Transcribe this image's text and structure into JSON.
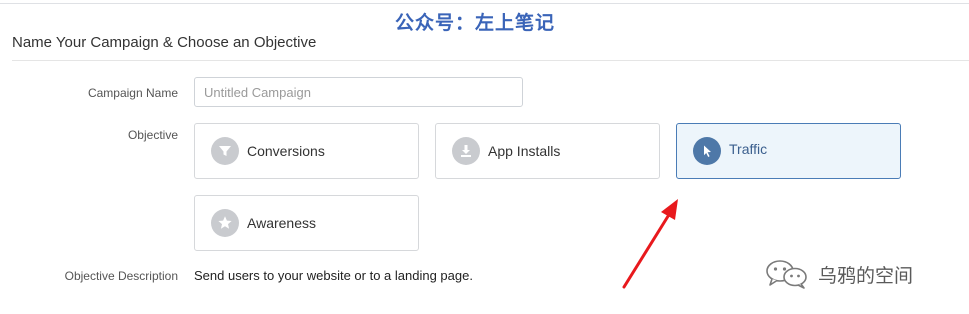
{
  "watermark": "公众号：左上笔记",
  "header": {
    "title": "Name Your Campaign & Choose an Objective"
  },
  "form": {
    "campaign_name_label": "Campaign Name",
    "campaign_name_placeholder": "Untitled Campaign",
    "campaign_name_value": "",
    "objective_label": "Objective",
    "objectives": [
      {
        "label": "Conversions",
        "icon": "funnel-icon",
        "selected": false
      },
      {
        "label": "App Installs",
        "icon": "download-icon",
        "selected": false
      },
      {
        "label": "Traffic",
        "icon": "cursor-icon",
        "selected": true
      },
      {
        "label": "Awareness",
        "icon": "star-icon",
        "selected": false
      }
    ],
    "description_label": "Objective Description",
    "description_text": "Send users to your website or to a landing page."
  },
  "annotation": {
    "arrow_color": "#e8191d"
  },
  "wechat_badge": {
    "text": "乌鸦的空间",
    "icon": "wechat-icon"
  },
  "colors": {
    "accent": "#4e78a8",
    "selected_bg": "#edf5fb",
    "icon_gray": "#c9cbcf"
  }
}
